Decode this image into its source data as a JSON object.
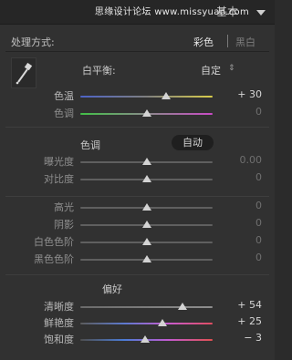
{
  "top": {
    "watermark": "思缘设计论坛  www.missyuan.com",
    "module_title": "基本"
  },
  "treatment": {
    "label": "处理方式:",
    "options": [
      "彩色",
      "黑白"
    ],
    "selected": "彩色"
  },
  "white_balance": {
    "title": "白平衡:",
    "preset": "自定",
    "chevron": "⇕"
  },
  "wb_sliders": [
    {
      "label": "色温",
      "value": "+ 30",
      "pos": 0.65,
      "gradient": "linear-gradient(to right,#4d63c7,#7f7f7f,#d9cd4a)",
      "dim": false
    },
    {
      "label": "色调",
      "value": "0",
      "pos": 0.5,
      "gradient": "linear-gradient(to right,#42c047,#8a8a8a,#c94ac6)",
      "dim": true
    }
  ],
  "tone": {
    "title": "色调",
    "auto_label": "自动"
  },
  "tone_sliders": [
    {
      "label": "曝光度",
      "value": "0.00",
      "pos": 0.5
    },
    {
      "label": "对比度",
      "value": "0",
      "pos": 0.5
    }
  ],
  "tone_sliders_2": [
    {
      "label": "高光",
      "value": "0",
      "pos": 0.5
    },
    {
      "label": "阴影",
      "value": "0",
      "pos": 0.5
    },
    {
      "label": "白色色阶",
      "value": "0",
      "pos": 0.5
    },
    {
      "label": "黑色色阶",
      "value": "0",
      "pos": 0.5
    }
  ],
  "presence": {
    "title": "偏好"
  },
  "presence_sliders": [
    {
      "label": "清晰度",
      "value": "+ 54",
      "pos": 0.77,
      "gradient": "linear-gradient(to right,#6a6a6a,#8e8e8e)"
    },
    {
      "label": "鲜艳度",
      "value": "+ 25",
      "pos": 0.62,
      "gradient": "linear-gradient(to right,#5c5c5c,#5d7ad0,#c95ccf,#e04d61)"
    },
    {
      "label": "饱和度",
      "value": "− 3",
      "pos": 0.49,
      "gradient": "linear-gradient(to right,#4e4e4e,#4b7cd6,#c35ad0,#e05050)"
    }
  ]
}
